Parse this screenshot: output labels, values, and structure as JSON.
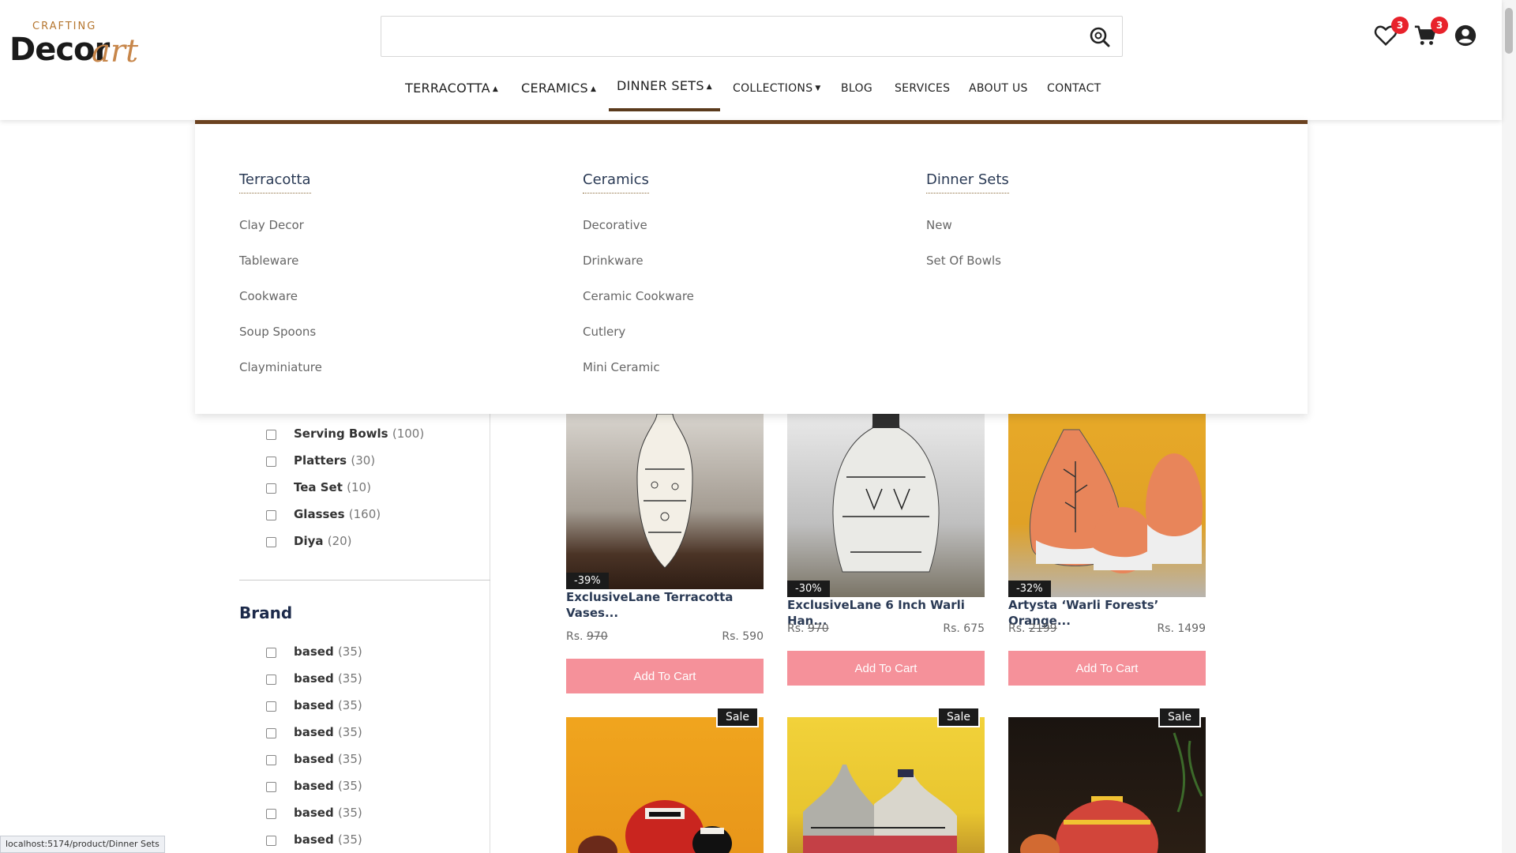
{
  "logo": {
    "crafting": "CRAFTING",
    "decor": "Decor",
    "art": "art"
  },
  "search": {
    "value": "",
    "placeholder": ""
  },
  "header_icons": {
    "wishlist_count": "3",
    "cart_count": "3"
  },
  "nav": [
    {
      "label": "TERRACOTTA",
      "caret": "▲"
    },
    {
      "label": "CERAMICS",
      "caret": "▲"
    },
    {
      "label": "DINNER SETS",
      "caret": "▲"
    },
    {
      "label": "COLLECTIONS",
      "caret": "▼"
    },
    {
      "label": "BLOG"
    },
    {
      "label": "SERVICES"
    },
    {
      "label": "ABOUT US"
    },
    {
      "label": "CONTACT"
    }
  ],
  "mega_menu": [
    {
      "heading": "Terracotta",
      "links": [
        "Clay Decor",
        "Tableware",
        "Cookware",
        "Soup Spoons",
        "Clayminiature"
      ]
    },
    {
      "heading": "Ceramics",
      "links": [
        "Decorative",
        "Drinkware",
        "Ceramic Cookware",
        "Cutlery",
        "Mini Ceramic"
      ]
    },
    {
      "heading": "Dinner Sets",
      "links": [
        "New",
        "Set Of Bowls"
      ]
    }
  ],
  "categories": [
    {
      "name": "Serving Bowls",
      "count": "(100)"
    },
    {
      "name": "Platters",
      "count": "(30)"
    },
    {
      "name": "Tea Set",
      "count": "(10)"
    },
    {
      "name": "Glasses",
      "count": "(160)"
    },
    {
      "name": "Diya",
      "count": "(20)"
    }
  ],
  "brand": {
    "heading": "Brand",
    "items": [
      {
        "name": "based",
        "count": "(35)"
      },
      {
        "name": "based",
        "count": "(35)"
      },
      {
        "name": "based",
        "count": "(35)"
      },
      {
        "name": "based",
        "count": "(35)"
      },
      {
        "name": "based",
        "count": "(35)"
      },
      {
        "name": "based",
        "count": "(35)"
      },
      {
        "name": "based",
        "count": "(35)"
      },
      {
        "name": "based",
        "count": "(35)"
      }
    ]
  },
  "products": [
    {
      "discount": "-39%",
      "title": "ExclusiveLane Terracotta Vases...",
      "price_prefix": "Rs.",
      "old_price": "970",
      "new_price": "Rs. 590",
      "button": "Add To Cart"
    },
    {
      "discount": "-30%",
      "title": "ExclusiveLane 6 Inch Warli Han...",
      "price_prefix": "Rs.",
      "old_price": "970",
      "new_price": "Rs. 675",
      "button": "Add To Cart"
    },
    {
      "discount": "-32%",
      "title": "Artysta ‘Warli Forests’ Orange...",
      "price_prefix": "Rs.",
      "old_price": "2199",
      "new_price": "Rs. 1499",
      "button": "Add To Cart"
    }
  ],
  "sale_badges": [
    "Sale",
    "Sale",
    "Sale"
  ],
  "status_bar": "localhost:5174/product/Dinner Sets",
  "colors": {
    "accent": "#6b4220",
    "button": "#f5919a",
    "badge": "#e8222b"
  }
}
